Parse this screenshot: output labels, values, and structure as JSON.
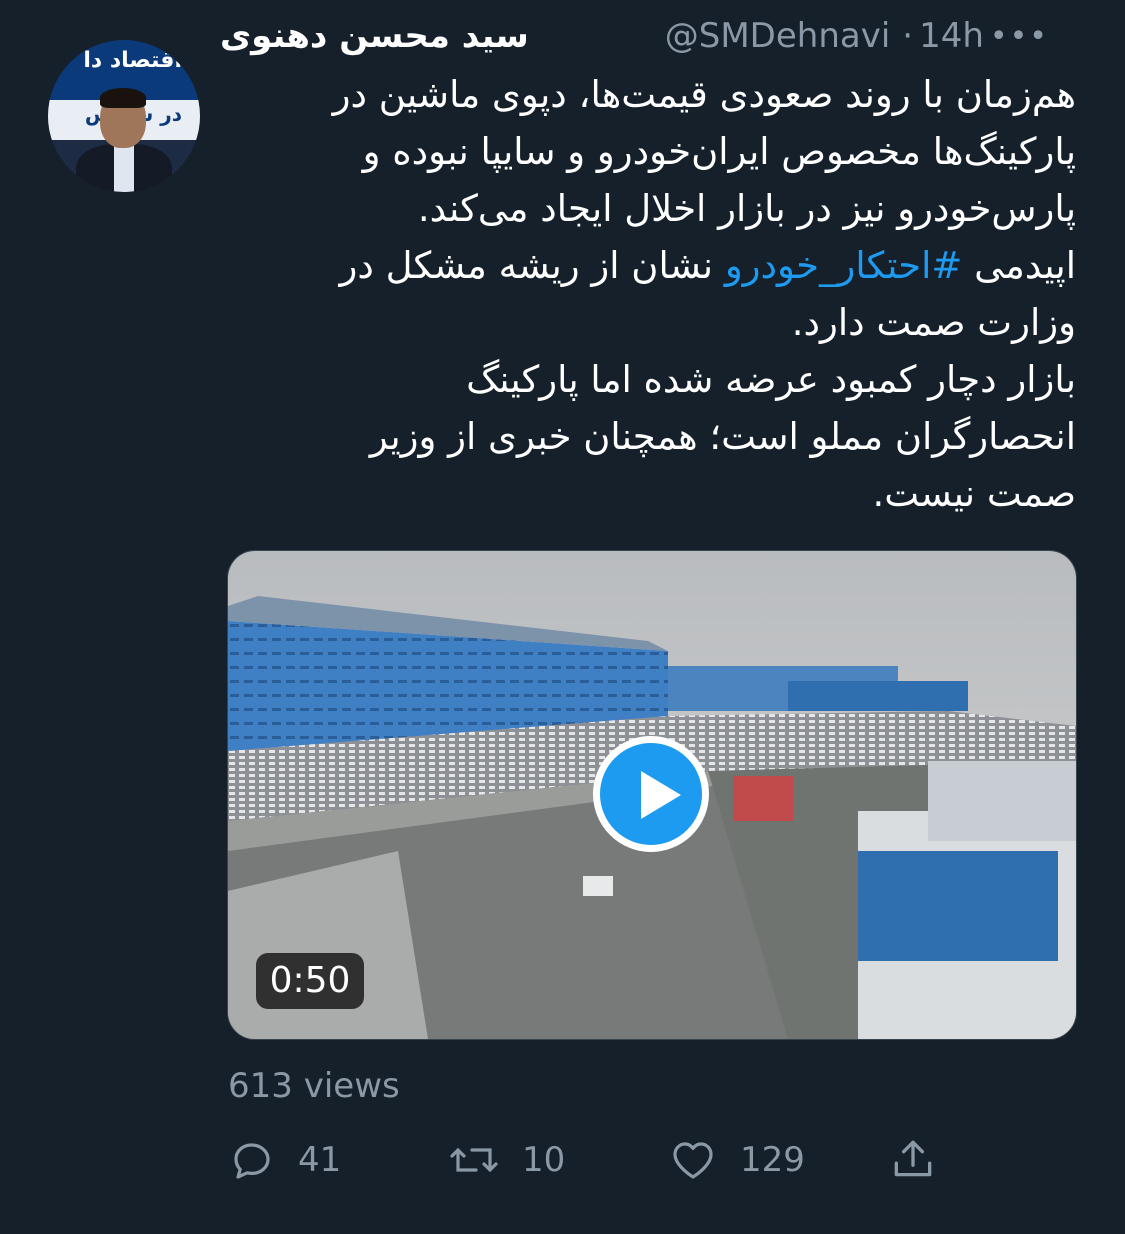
{
  "tweet": {
    "author_name": "سید محسن دهنوی",
    "handle": "@SMDehnavi",
    "separator": "·",
    "time": "14h",
    "more_label": "•••",
    "text_lines": {
      "l1": "هم‌زمان با روند صعودی قیمت‌ها، دپوی ماشین در",
      "l2": "پارکینگ‌ها مخصوص ایران‌خودرو و سایپا نبوده و",
      "l3": "پارس‌خودرو نیز در بازار اخلال ایجاد می‌کند.",
      "l4_prefix": "اپیدمی ",
      "l4_hashtag": "#احتکار_خودرو",
      "l4_suffix": " نشان از ریشه مشکل در",
      "l5": "وزارت صمت دارد.",
      "l6": "بازار دچار کمبود عرضه شده اما پارکینگ",
      "l7": "انحصارگران مملو است؛ همچنان خبری از وزیر",
      "l8": "صمت نیست."
    },
    "video_duration": "0:50",
    "views": "613 views",
    "replies": "41",
    "retweets": "10",
    "likes": "129"
  },
  "avatar_text": {
    "line1": "اقتصاد دا",
    "line2": "در ســـس"
  },
  "colors": {
    "background": "#15202b",
    "accent": "#1d9bf0",
    "secondary_text": "#8b98a5"
  }
}
